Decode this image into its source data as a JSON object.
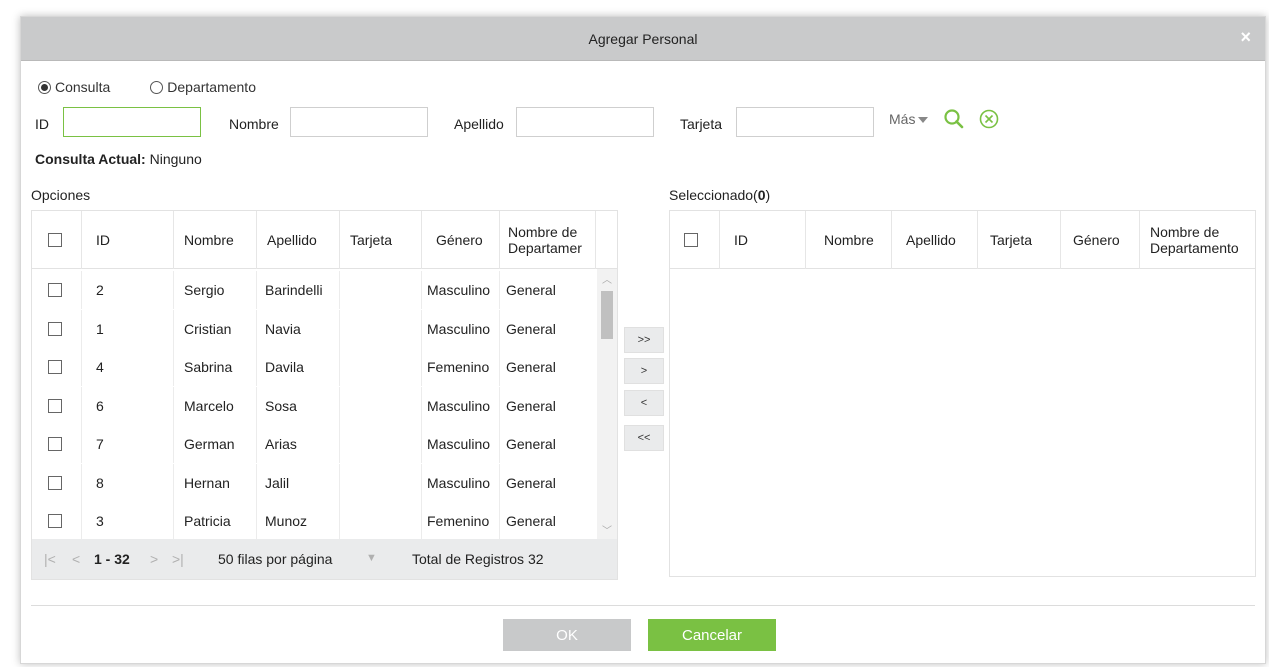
{
  "dialog": {
    "title": "Agregar Personal",
    "close_glyph": "×"
  },
  "search_mode": {
    "option_query": "Consulta",
    "option_department": "Departamento",
    "selected": "Consulta"
  },
  "filters": {
    "id_label": "ID",
    "id_value": "",
    "name_label": "Nombre",
    "name_value": "",
    "surname_label": "Apellido",
    "surname_value": "",
    "card_label": "Tarjeta",
    "card_value": "",
    "more_label": "Más"
  },
  "current_query": {
    "label": "Consulta Actual:",
    "value": "Ninguno"
  },
  "options": {
    "title": "Opciones",
    "columns": [
      "ID",
      "Nombre",
      "Apellido",
      "Tarjeta",
      "Género",
      "Nombre de Departamer"
    ],
    "rows": [
      [
        "2",
        "Sergio",
        "Barindelli",
        "",
        "Masculino",
        "General"
      ],
      [
        "1",
        "Cristian",
        "Navia",
        "",
        "Masculino",
        "General"
      ],
      [
        "4",
        "Sabrina",
        "Davila",
        "",
        "Femenino",
        "General"
      ],
      [
        "6",
        "Marcelo",
        "Sosa",
        "",
        "Masculino",
        "General"
      ],
      [
        "7",
        "German",
        "Arias",
        "",
        "Masculino",
        "General"
      ],
      [
        "8",
        "Hernan",
        "Jalil",
        "",
        "Masculino",
        "General"
      ],
      [
        "3",
        "Patricia",
        "Munoz",
        "",
        "Femenino",
        "General"
      ]
    ],
    "pager": {
      "first": "|<",
      "prev": "<",
      "range": "1 - 32",
      "next": ">",
      "last": ">|",
      "page_size": "50 filas por página",
      "total": "Total de Registros 32"
    }
  },
  "transfer": {
    "all_right": ">>",
    "right": ">",
    "left": "<",
    "all_left": "<<"
  },
  "selected": {
    "title_prefix": "Seleccionado(",
    "count": "0",
    "title_suffix": ")",
    "columns": [
      "ID",
      "Nombre",
      "Apellido",
      "Tarjeta",
      "Género",
      "Nombre de Departamento"
    ]
  },
  "footer": {
    "ok": "OK",
    "cancel": "Cancelar"
  },
  "colors": {
    "accent": "#7ac143",
    "titlebar": "#c9cacb",
    "disabled": "#c8c9ca"
  }
}
